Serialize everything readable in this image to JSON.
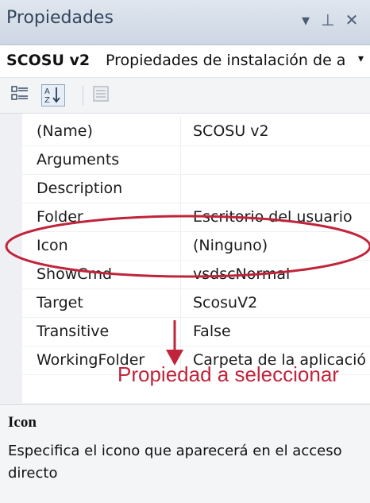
{
  "window": {
    "title": "Propiedades",
    "buttons": {
      "dropdown": "▾",
      "pin": "⊥",
      "close": "✕"
    }
  },
  "selector": {
    "object_name": "SCOSU v2",
    "object_type": "Propiedades de instalación de a",
    "caret": "▾"
  },
  "toolbar": {
    "categorized_icon": "categorized-icon",
    "alphabetical_icon": "alphabetical-icon",
    "alphabetical_glyph": "A↓",
    "pages_icon": "property-pages-icon"
  },
  "properties": [
    {
      "name": "(Name)",
      "value": "SCOSU v2"
    },
    {
      "name": "Arguments",
      "value": ""
    },
    {
      "name": "Description",
      "value": ""
    },
    {
      "name": "Folder",
      "value": "Escritorio del usuario"
    },
    {
      "name": "Icon",
      "value": "(Ninguno)"
    },
    {
      "name": "ShowCmd",
      "value": "vsdscNormal"
    },
    {
      "name": "Target",
      "value": "ScosuV2"
    },
    {
      "name": "Transitive",
      "value": "False"
    },
    {
      "name": "WorkingFolder",
      "value": "Carpeta de la aplicació"
    }
  ],
  "annotation": {
    "caption": "Propiedad a seleccionar",
    "color": "#c0243a"
  },
  "description": {
    "title": "Icon",
    "text": "Especifica el icono que aparecerá en el acceso directo"
  }
}
